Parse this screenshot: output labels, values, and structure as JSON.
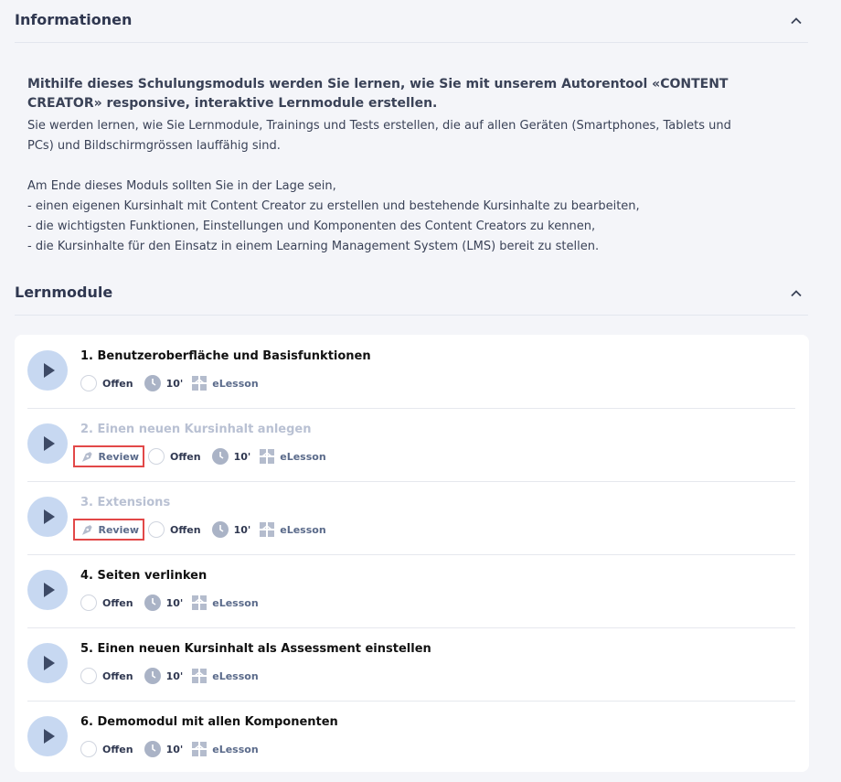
{
  "info_section": {
    "title": "Informationen",
    "lead": "Mithilfe dieses Schulungsmoduls werden Sie lernen, wie Sie mit unserem Autorentool «CONTENT CREATOR» responsive, interaktive Lernmodule erstellen.",
    "para1": "Sie werden lernen, wie Sie Lernmodule, Trainings und Tests erstellen, die auf allen Geräten (Smartphones, Tablets und PCs) und Bildschirmgrössen lauffähig sind.",
    "intro": "Am Ende dieses Moduls sollten Sie in der Lage sein,",
    "bullets": [
      "- einen eigenen Kursinhalt mit Content Creator zu erstellen und bestehende Kursinhalte zu bearbeiten,",
      "- die wichtigsten Funktionen, Einstellungen und Komponenten des Content Creators zu kennen,",
      "- die Kursinhalte für den Einsatz in einem Learning Management System (LMS) bereit zu stellen."
    ]
  },
  "modules_section": {
    "title": "Lernmodule",
    "modules": [
      {
        "title": "1. Benutzeroberfläche und Basisfunktionen",
        "status": "Offen",
        "duration": "10'",
        "type": "eLesson"
      },
      {
        "title": "2. Einen neuen Kursinhalt anlegen",
        "review": "Review",
        "status": "Offen",
        "duration": "10'",
        "type": "eLesson"
      },
      {
        "title": "3. Extensions",
        "review": "Review",
        "status": "Offen",
        "duration": "10'",
        "type": "eLesson"
      },
      {
        "title": "4. Seiten verlinken",
        "status": "Offen",
        "duration": "10'",
        "type": "eLesson"
      },
      {
        "title": "5. Einen neuen Kursinhalt als Assessment einstellen",
        "status": "Offen",
        "duration": "10'",
        "type": "eLesson"
      },
      {
        "title": "6. Demomodul mit allen Komponenten",
        "status": "Offen",
        "duration": "10'",
        "type": "eLesson"
      }
    ]
  },
  "icons": {
    "collapse": "chevron-up-icon",
    "play": "play-icon",
    "status": "status-circle-icon",
    "duration": "clock-icon",
    "type": "elesson-icon",
    "review": "pen-nib-icon"
  },
  "colors": {
    "background": "#f4f5f9",
    "card": "#ffffff",
    "play_button": "#c7d8f1",
    "highlight_border": "#e24848",
    "disabled_title": "#b9c1d3"
  }
}
